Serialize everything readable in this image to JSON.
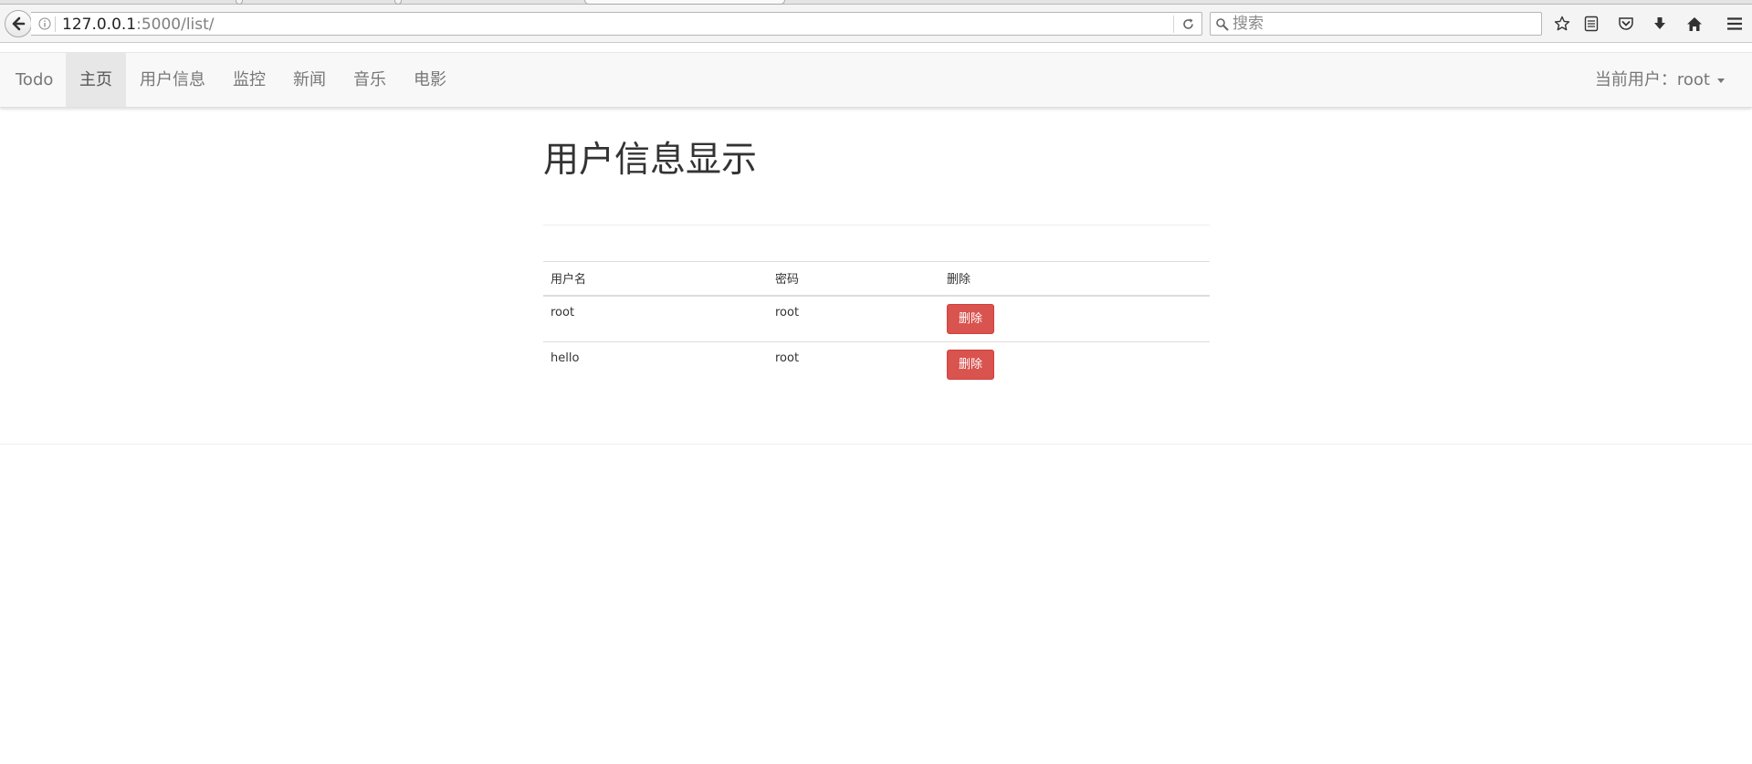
{
  "browser": {
    "url_host": "127.0.0.1",
    "url_rest": ":5000/list/",
    "search_placeholder": "搜索"
  },
  "navbar": {
    "brand": "Todo",
    "items": [
      {
        "label": "主页",
        "active": true
      },
      {
        "label": "用户信息",
        "active": false
      },
      {
        "label": "监控",
        "active": false
      },
      {
        "label": "新闻",
        "active": false
      },
      {
        "label": "音乐",
        "active": false
      },
      {
        "label": "电影",
        "active": false
      }
    ],
    "current_user": "当前用户：root"
  },
  "main": {
    "title": "用户信息显示",
    "table": {
      "headers": [
        "用户名",
        "密码",
        "删除"
      ],
      "rows": [
        {
          "username": "root",
          "password": "root",
          "delete_label": "删除"
        },
        {
          "username": "hello",
          "password": "root",
          "delete_label": "删除"
        }
      ]
    }
  },
  "colors": {
    "danger": "#d9534f",
    "navbar_bg": "#f8f8f8",
    "active_nav_bg": "#e7e7e7"
  }
}
